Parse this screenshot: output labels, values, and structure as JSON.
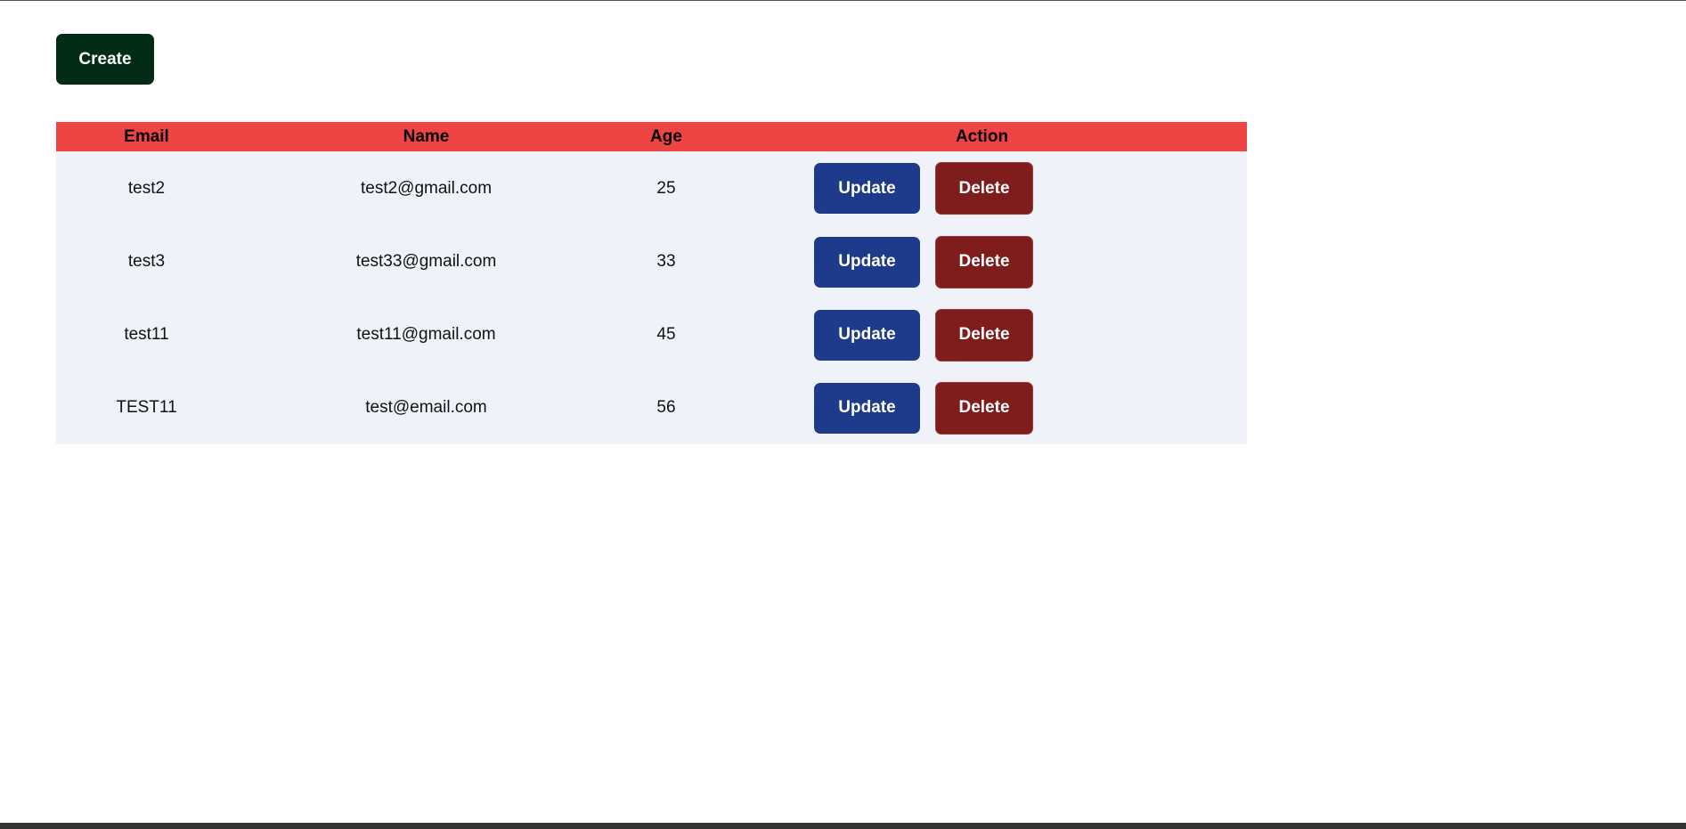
{
  "create_label": "Create",
  "table": {
    "headers": [
      "Email",
      "Name",
      "Age",
      "Action"
    ],
    "rows": [
      {
        "email": "test2",
        "name": "test2@gmail.com",
        "age": "25"
      },
      {
        "email": "test3",
        "name": "test33@gmail.com",
        "age": "33"
      },
      {
        "email": "test11",
        "name": "test11@gmail.com",
        "age": "45"
      },
      {
        "email": "TEST11",
        "name": "test@email.com",
        "age": "56"
      }
    ],
    "update_label": "Update",
    "delete_label": "Delete"
  },
  "colors": {
    "create_button": "#022c16",
    "header_bg": "#ef4444",
    "row_bg": "#eff3f9",
    "update_button": "#1e3a8a",
    "delete_button": "#7f1d1d"
  }
}
